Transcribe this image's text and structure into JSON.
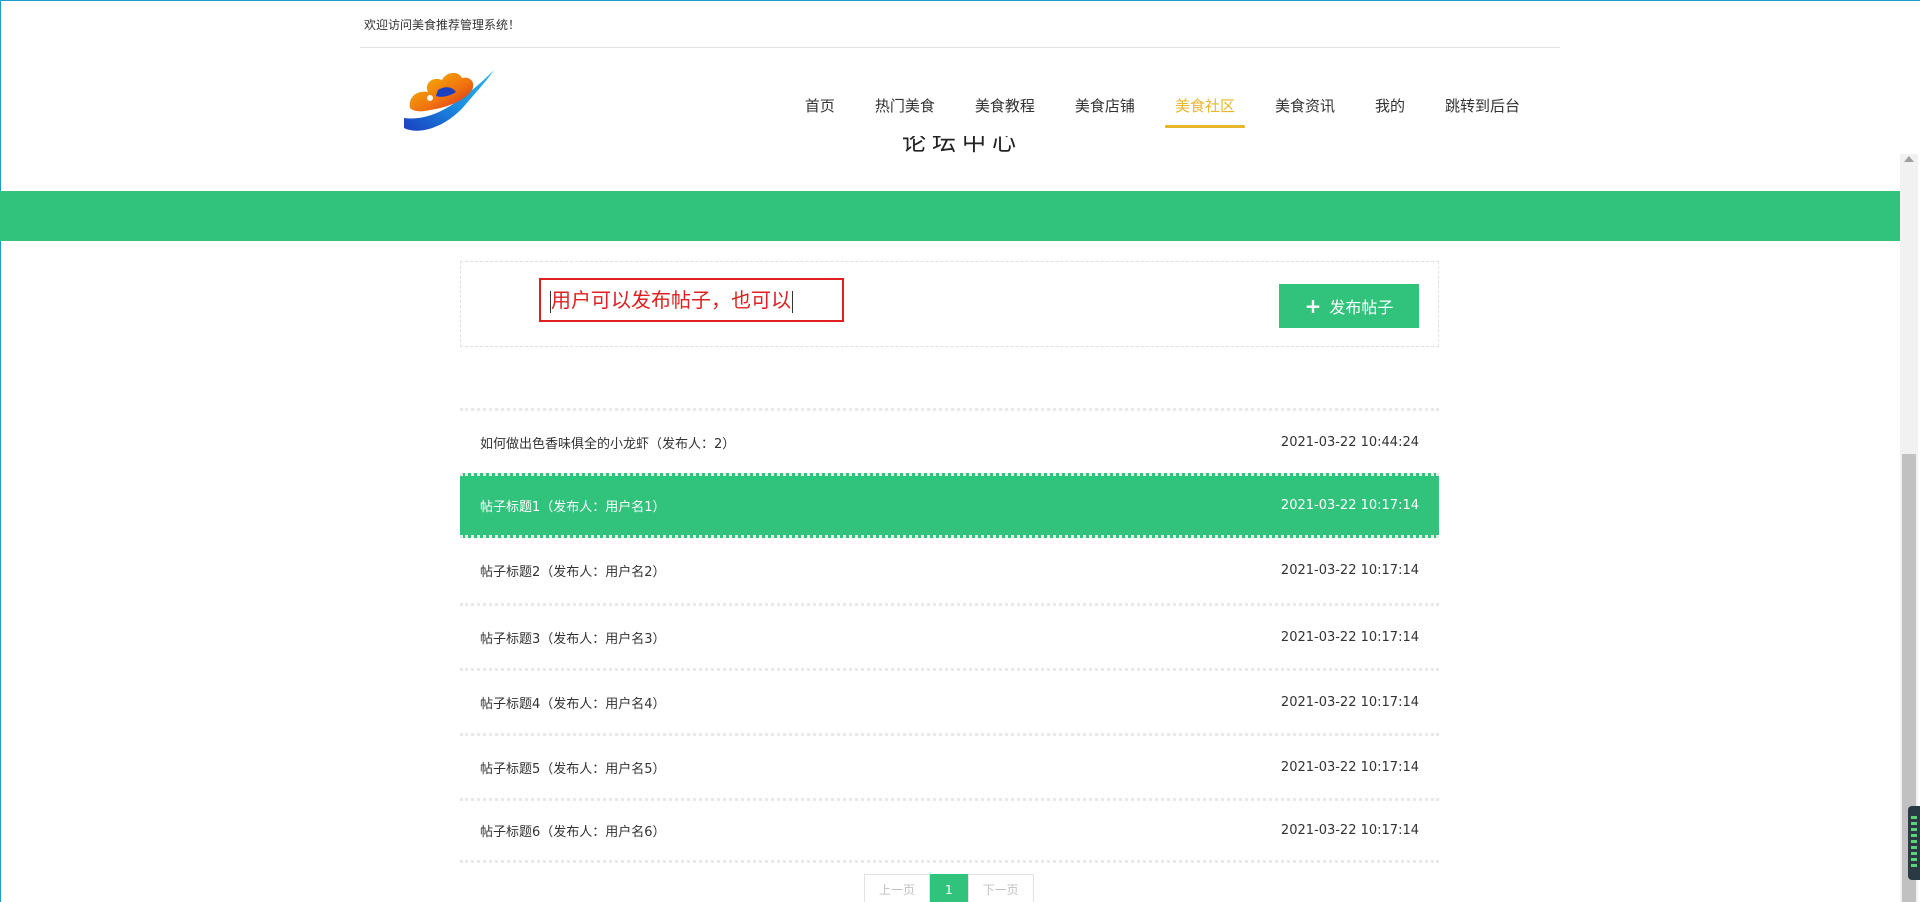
{
  "header": {
    "welcome": "欢迎访问美食推荐管理系统！",
    "nav": [
      {
        "label": "首页",
        "active": false
      },
      {
        "label": "热门美食",
        "active": false
      },
      {
        "label": "美食教程",
        "active": false
      },
      {
        "label": "美食店铺",
        "active": false
      },
      {
        "label": "美食社区",
        "active": true
      },
      {
        "label": "美食资讯",
        "active": false
      },
      {
        "label": "我的",
        "active": false
      },
      {
        "label": "跳转到后台",
        "active": false
      }
    ]
  },
  "page": {
    "heading": "论坛中心"
  },
  "annotation": {
    "text": "用户可以发布帖子，也可以"
  },
  "actions": {
    "publish_label": "发布帖子"
  },
  "posts": [
    {
      "title": "如何做出色香味俱全的小龙虾（发布人：2）",
      "time": "2021-03-22 10:44:24",
      "active": false
    },
    {
      "title": "帖子标题1（发布人：用户名1）",
      "time": "2021-03-22 10:17:14",
      "active": true
    },
    {
      "title": "帖子标题2（发布人：用户名2）",
      "time": "2021-03-22 10:17:14",
      "active": false
    },
    {
      "title": "帖子标题3（发布人：用户名3）",
      "time": "2021-03-22 10:17:14",
      "active": false
    },
    {
      "title": "帖子标题4（发布人：用户名4）",
      "time": "2021-03-22 10:17:14",
      "active": false
    },
    {
      "title": "帖子标题5（发布人：用户名5）",
      "time": "2021-03-22 10:17:14",
      "active": false
    },
    {
      "title": "帖子标题6（发布人：用户名6）",
      "time": "2021-03-22 10:17:14",
      "active": false
    }
  ],
  "pagination": {
    "prev_label": "上一页",
    "current": "1",
    "next_label": "下一页"
  },
  "colors": {
    "brand_green": "#31c27c",
    "active_nav": "#e8b62a",
    "annotation_red": "#e02020"
  }
}
